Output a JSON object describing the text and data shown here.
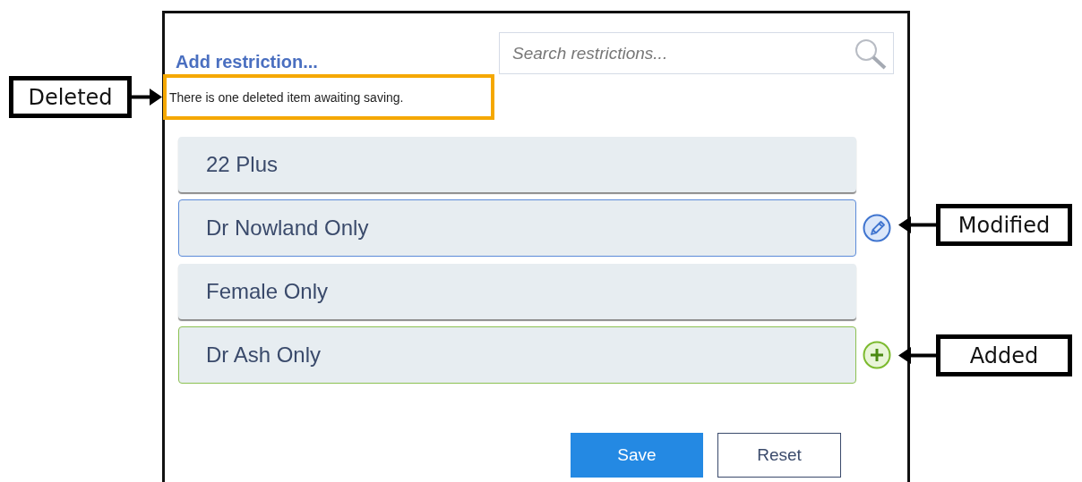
{
  "panel": {
    "add_link": "Add restriction...",
    "notice": "There is one deleted item awaiting saving.",
    "search": {
      "placeholder": "Search restrictions..."
    },
    "items": [
      {
        "label": "22 Plus",
        "kind": "plain"
      },
      {
        "label": "Dr Nowland Only",
        "kind": "modified"
      },
      {
        "label": "Female Only",
        "kind": "plain"
      },
      {
        "label": "Dr Ash Only",
        "kind": "added"
      }
    ],
    "buttons": [
      {
        "label": "Save",
        "kind": "primary"
      },
      {
        "label": "Reset",
        "kind": "secondary"
      }
    ]
  },
  "callouts": [
    {
      "label": "Deleted",
      "kind": "right"
    },
    {
      "label": "Modified",
      "kind": "left"
    },
    {
      "label": "Added",
      "kind": "left"
    }
  ]
}
